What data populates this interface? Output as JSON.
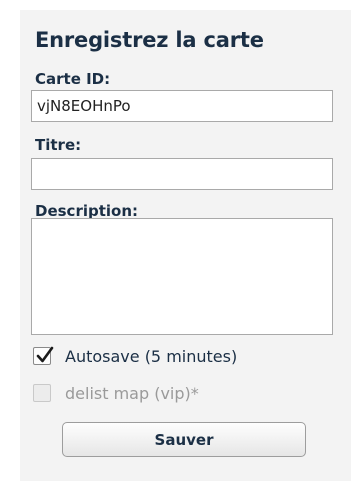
{
  "form": {
    "title": "Enregistrez la carte",
    "map_id": {
      "label": "Carte ID:",
      "value": "vjN8EOHnPo"
    },
    "titre": {
      "label": "Titre:",
      "value": ""
    },
    "description": {
      "label": "Description:",
      "value": ""
    },
    "autosave": {
      "label": "Autosave (5 minutes)",
      "checked": true
    },
    "delist": {
      "label": "delist map (vip)*",
      "checked": false,
      "disabled": true
    },
    "save_label": "Sauver"
  },
  "colors": {
    "panel_background": "#f3f3f3",
    "heading_text": "#1b2f45",
    "disabled_text": "#9a9a9a"
  },
  "icons": {
    "autosave_checkbox": "checkmark-icon"
  }
}
